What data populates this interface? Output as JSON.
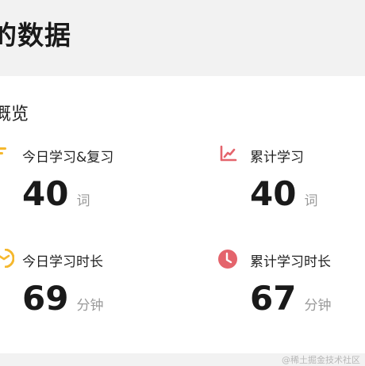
{
  "page": {
    "title": "的数据"
  },
  "overview": {
    "title": "概览",
    "stats": [
      {
        "label": "今日学习&复习",
        "value": "40",
        "unit": "词",
        "icon": "bars-icon",
        "color": "#f5b82e"
      },
      {
        "label": "累计学习",
        "value": "40",
        "unit": "词",
        "icon": "line-chart-icon",
        "color": "#e4646c"
      },
      {
        "label": "今日学习时长",
        "value": "69",
        "unit": "分钟",
        "icon": "half-clock-icon",
        "color": "#f5b82e"
      },
      {
        "label": "累计学习时长",
        "value": "67",
        "unit": "分钟",
        "icon": "clock-icon",
        "color": "#e4646c"
      }
    ]
  },
  "watermark": "@稀土掘金技术社区"
}
